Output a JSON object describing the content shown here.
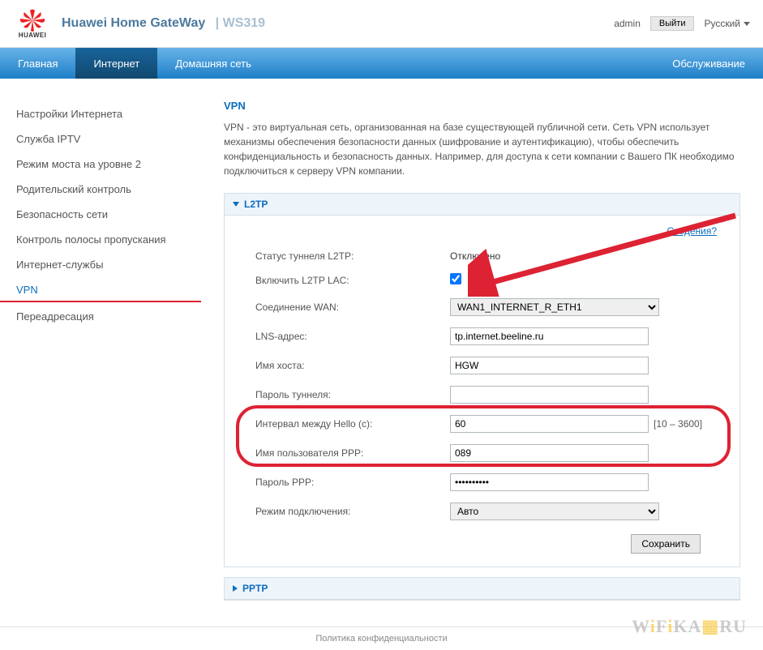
{
  "header": {
    "logo_text": "HUAWEI",
    "brand": "Huawei Home GateWay",
    "model": "WS319",
    "admin_label": "admin",
    "logout_label": "Выйти",
    "language": "Русский"
  },
  "nav": {
    "items": [
      "Главная",
      "Интернет",
      "Домашняя сеть"
    ],
    "right": "Обслуживание",
    "active_index": 1
  },
  "sidebar": {
    "items": [
      "Настройки Интернета",
      "Служба IPTV",
      "Режим моста на уровне 2",
      "Родительский контроль",
      "Безопасность сети",
      "Контроль полосы пропускания",
      "Интернет-службы",
      "VPN",
      "Переадресация"
    ],
    "active_index": 7
  },
  "page": {
    "title": "VPN",
    "description": "VPN - это виртуальная сеть, организованная на базе существующей публичной сети. Сеть VPN использует механизмы обеспечения безопасности данных (шифрование и аутентификацию), чтобы обеспечить конфиденциальность и безопасность данных. Например, для доступа к сети компании с Вашего ПК необходимо подключиться к серверу VPN компании."
  },
  "l2tp": {
    "panel_title": "L2TP",
    "details_link": "Сведения?",
    "fields": {
      "status_label": "Статус туннеля L2TP:",
      "status_value": "Отключено",
      "enable_label": "Включить L2TP LAC:",
      "enable_checked": true,
      "wan_label": "Соединение WAN:",
      "wan_value": "WAN1_INTERNET_R_ETH1",
      "lns_label": "LNS-адрес:",
      "lns_value": "tp.internet.beeline.ru",
      "host_label": "Имя хоста:",
      "host_value": "HGW",
      "tunnel_pwd_label": "Пароль туннеля:",
      "tunnel_pwd_value": "",
      "hello_label": "Интервал между Hello (с):",
      "hello_value": "60",
      "hello_hint": "[10 – 3600]",
      "ppp_user_label": "Имя пользователя PPP:",
      "ppp_user_value": "089",
      "ppp_pwd_label": "Пароль PPP:",
      "ppp_pwd_value": "••••••••••",
      "mode_label": "Режим подключения:",
      "mode_value": "Авто"
    },
    "save_label": "Сохранить"
  },
  "pptp": {
    "panel_title": "PPTP"
  },
  "footer": {
    "text": "Политика конфиденциальности"
  },
  "watermark": "WiFiKA.RU"
}
